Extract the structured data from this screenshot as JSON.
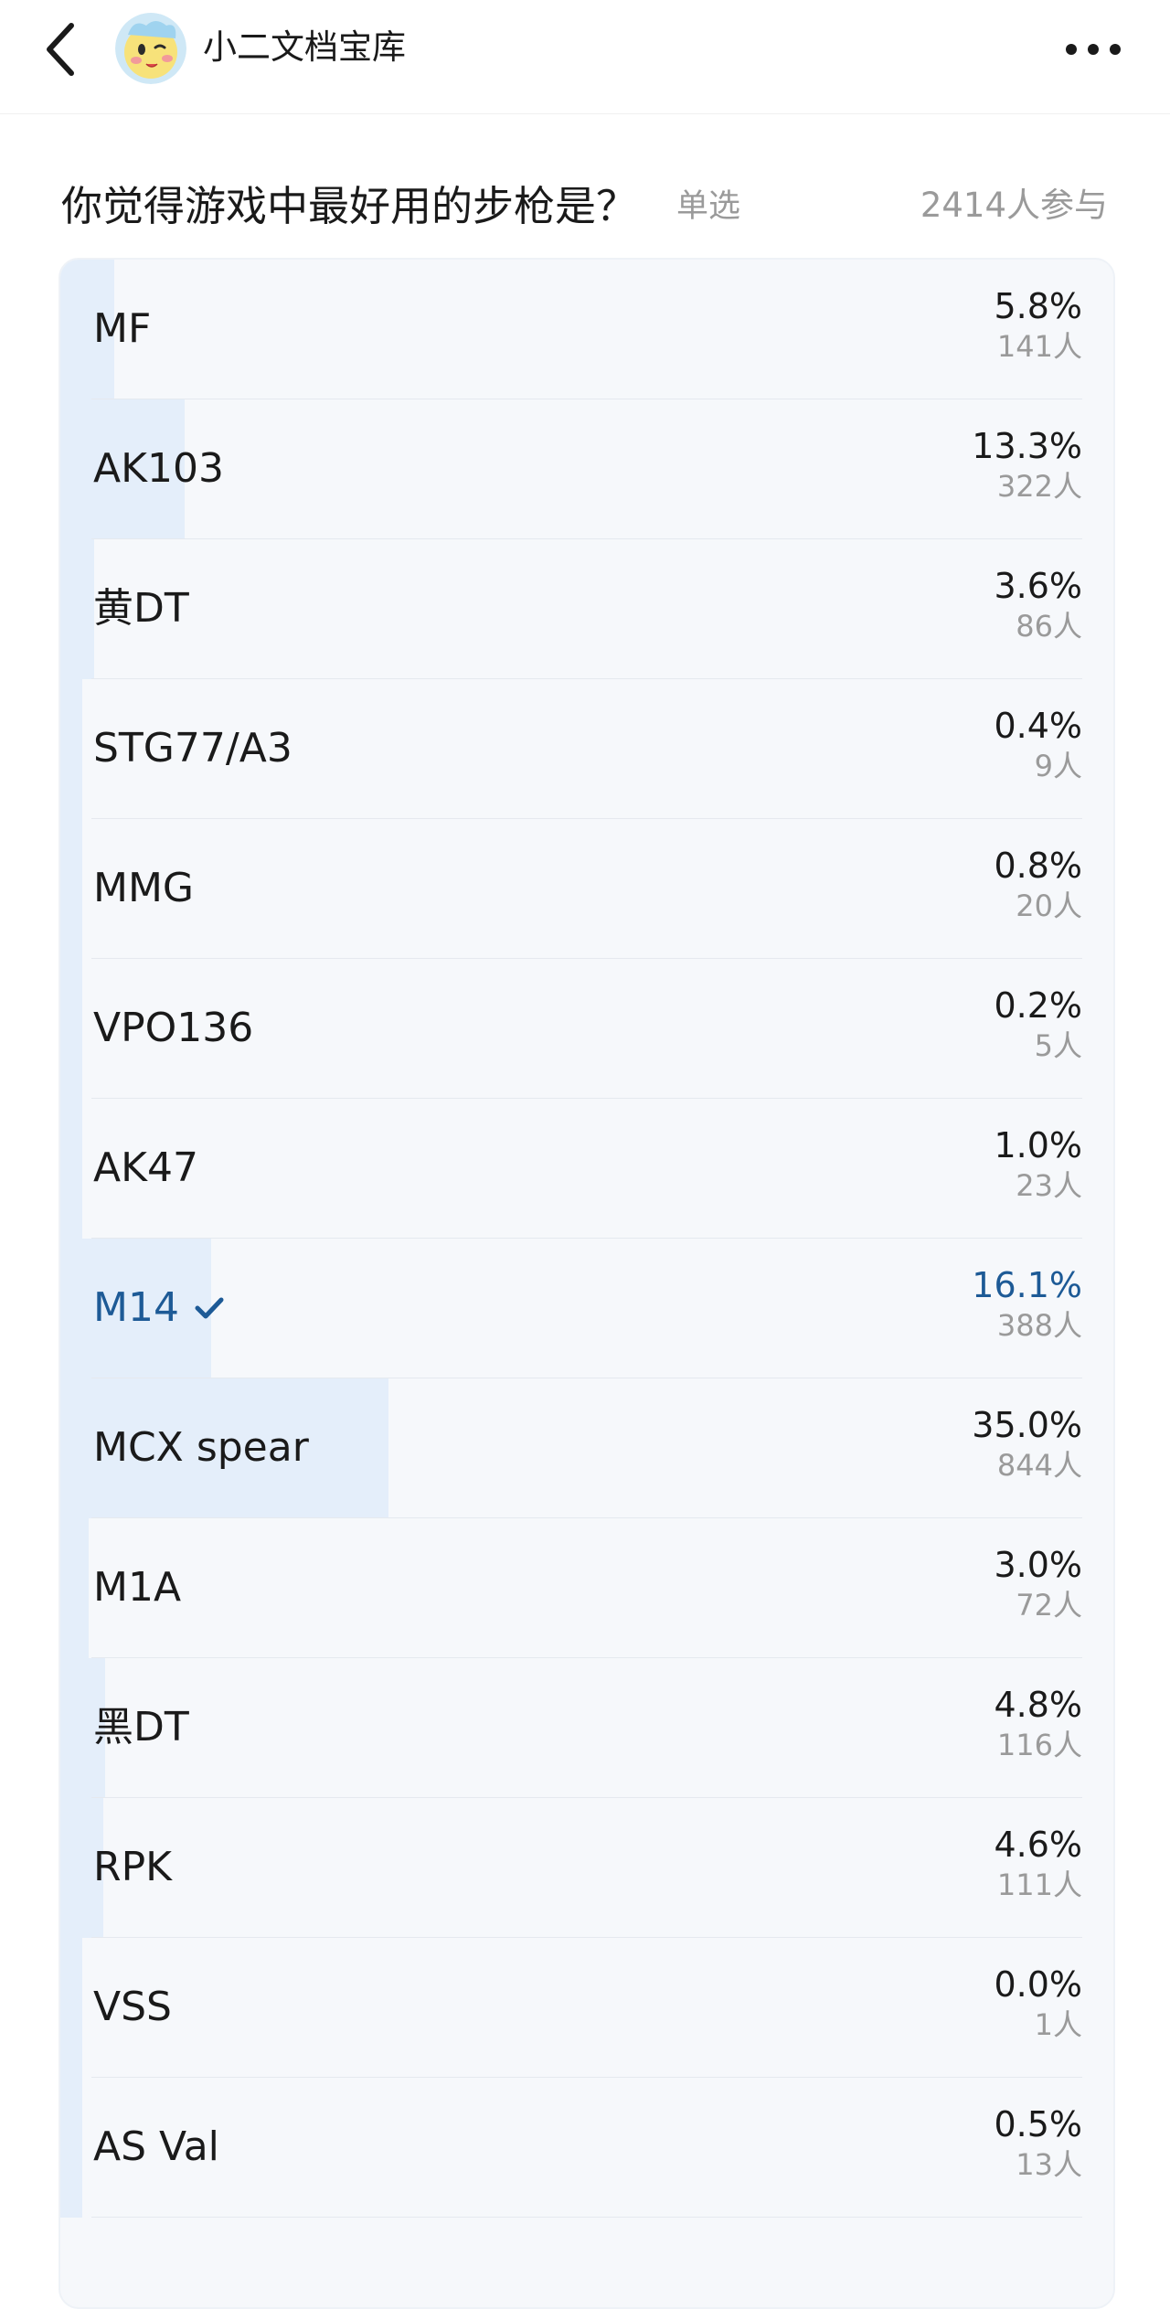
{
  "header": {
    "back_icon": "chevron-left-icon",
    "title": "小二文档宝库",
    "avatar_icon": "avatar-cartoon-icon",
    "more_icon": "more-horizontal-icon"
  },
  "poll": {
    "question": "你觉得游戏中最好用的步枪是？",
    "type": "单选",
    "participants": "2414人参与",
    "accent_color": "#1d5a96",
    "bar_color": "#e4eefa",
    "selected_color": "#1d5a96",
    "options": [
      {
        "label": "MF",
        "percent": "5.8%",
        "count": "141人",
        "fraction": 0.058,
        "selected": false
      },
      {
        "label": "AK103",
        "percent": "13.3%",
        "count": "322人",
        "fraction": 0.133,
        "selected": false
      },
      {
        "label": "黄DT",
        "percent": "3.6%",
        "count": "86人",
        "fraction": 0.036,
        "selected": false
      },
      {
        "label": "STG77/A3",
        "percent": "0.4%",
        "count": "9人",
        "fraction": 0.004,
        "selected": false
      },
      {
        "label": "MMG",
        "percent": "0.8%",
        "count": "20人",
        "fraction": 0.008,
        "selected": false
      },
      {
        "label": "VPO136",
        "percent": "0.2%",
        "count": "5人",
        "fraction": 0.002,
        "selected": false
      },
      {
        "label": "AK47",
        "percent": "1.0%",
        "count": "23人",
        "fraction": 0.01,
        "selected": false
      },
      {
        "label": "M14",
        "percent": "16.1%",
        "count": "388人",
        "fraction": 0.161,
        "selected": true
      },
      {
        "label": "MCX spear",
        "percent": "35.0%",
        "count": "844人",
        "fraction": 0.35,
        "selected": false
      },
      {
        "label": "M1A",
        "percent": "3.0%",
        "count": "72人",
        "fraction": 0.03,
        "selected": false
      },
      {
        "label": "黑DT",
        "percent": "4.8%",
        "count": "116人",
        "fraction": 0.048,
        "selected": false
      },
      {
        "label": "RPK",
        "percent": "4.6%",
        "count": "111人",
        "fraction": 0.046,
        "selected": false
      },
      {
        "label": "VSS",
        "percent": "0.0%",
        "count": "1人",
        "fraction": 0.0,
        "selected": false
      },
      {
        "label": "AS Val",
        "percent": "0.5%",
        "count": "13人",
        "fraction": 0.005,
        "selected": false
      }
    ]
  }
}
